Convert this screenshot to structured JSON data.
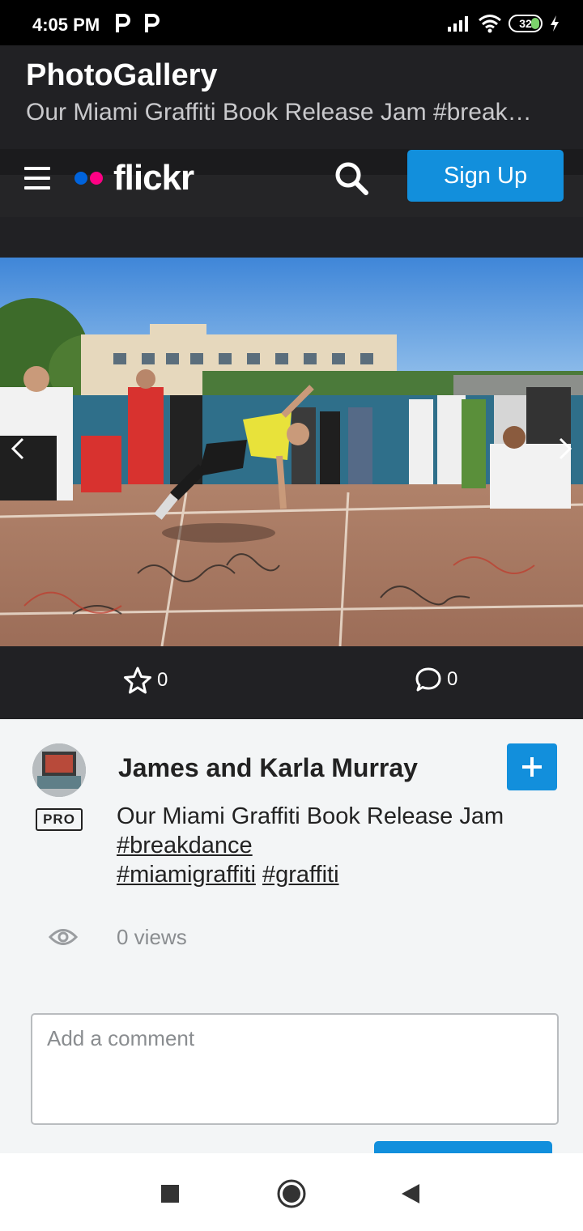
{
  "status_bar": {
    "time": "4:05 PM",
    "battery": "32",
    "icons": [
      "parking-icon",
      "parking-icon",
      "signal-icon",
      "wifi-icon",
      "battery-icon",
      "charging-icon"
    ]
  },
  "app": {
    "title": "PhotoGallery",
    "subtitle": "Our Miami Graffiti Book Release Jam #breakdance #miamigraffiti #graffiti"
  },
  "flickr_nav": {
    "logo_text": "flickr",
    "signup_label": "Sign Up",
    "colors": {
      "blue": "#0063dc",
      "pink": "#ff0084",
      "button": "#128fdc"
    }
  },
  "stats": {
    "favorites": "0",
    "comments": "0"
  },
  "photo_info": {
    "author": "James and Karla Murray",
    "pro_label": "PRO",
    "description_prefix": "Our Miami Graffiti Book Release Jam ",
    "tags": [
      "#breakdance",
      "#miamigraffiti",
      "#graffiti"
    ],
    "views": "0 views"
  },
  "comment": {
    "placeholder": "Add a comment"
  }
}
